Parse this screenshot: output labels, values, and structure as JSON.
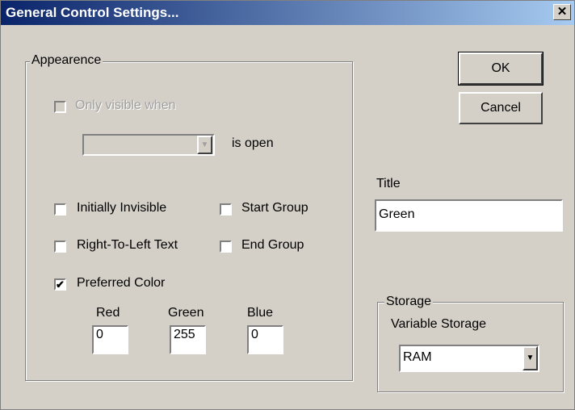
{
  "title_bar": {
    "title": "General Control Settings...",
    "close_glyph": "✕"
  },
  "appearance": {
    "legend": "Appearence",
    "only_visible_label": "Only visible when",
    "only_visible_checked": false,
    "dropdown_value": "",
    "is_open_label": "is open",
    "initially_invisible": {
      "label": "Initially Invisible",
      "checked": false
    },
    "start_group": {
      "label": "Start Group",
      "checked": false
    },
    "right_to_left": {
      "label": "Right-To-Left Text",
      "checked": false
    },
    "end_group": {
      "label": "End Group",
      "checked": false
    },
    "preferred_color": {
      "label": "Preferred Color",
      "checked": true,
      "mark": "✔"
    },
    "red": {
      "label": "Red",
      "value": "0"
    },
    "green": {
      "label": "Green",
      "value": "255"
    },
    "blue": {
      "label": "Blue",
      "value": "0"
    }
  },
  "buttons": {
    "ok": "OK",
    "cancel": "Cancel"
  },
  "title_field": {
    "label": "Title",
    "value": "Green"
  },
  "storage": {
    "legend": "Storage",
    "variable_label": "Variable Storage",
    "selected": "RAM",
    "arrow_glyph": "▼"
  }
}
